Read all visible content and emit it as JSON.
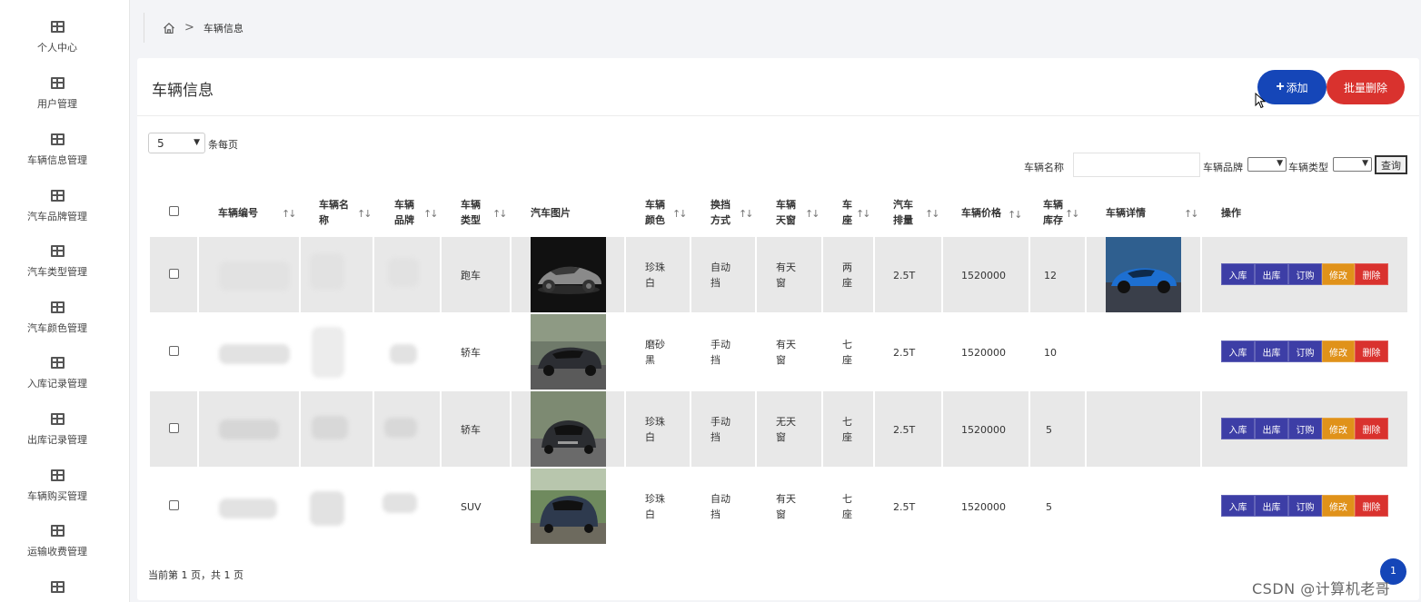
{
  "sidebar": {
    "items": [
      {
        "label": "个人中心"
      },
      {
        "label": "用户管理"
      },
      {
        "label": "车辆信息管理"
      },
      {
        "label": "汽车品牌管理"
      },
      {
        "label": "汽车类型管理"
      },
      {
        "label": "汽车颜色管理"
      },
      {
        "label": "入库记录管理"
      },
      {
        "label": "出库记录管理"
      },
      {
        "label": "车辆购买管理"
      },
      {
        "label": "运输收费管理"
      },
      {
        "label": ""
      }
    ]
  },
  "breadcrumb": {
    "separator": ">",
    "current": "车辆信息"
  },
  "page": {
    "title": "车辆信息"
  },
  "actions": {
    "add_label": "添加",
    "add_icon": "+",
    "batch_delete_label": "批量删除"
  },
  "pagination": {
    "page_size": "5",
    "per_page_label": "条每页",
    "footer": "当前第 1 页，共 1 页",
    "current_page": "1"
  },
  "search": {
    "name_label": "车辆名称",
    "name_value": "",
    "brand_label": "车辆品牌",
    "type_label": "车辆类型",
    "query_label": "查询"
  },
  "table": {
    "headers": {
      "id": "车辆编号",
      "name": "车辆名称",
      "brand": "车辆品牌",
      "type": "车辆类型",
      "image": "汽车图片",
      "color": "车辆颜色",
      "gear": "换挡方式",
      "sunroof": "车辆天窗",
      "seats": "车座",
      "displacement": "汽车排量",
      "price": "车辆价格",
      "stock": "车辆库存",
      "details": "车辆详情",
      "ops": "操作"
    },
    "sort_icon": "↑↓",
    "rows": [
      {
        "type": "跑车",
        "color": "珍珠白",
        "gear": "自动挡",
        "sunroof": "有天窗",
        "seats": "两座",
        "displacement": "2.5T",
        "price": "1520000",
        "stock": "12",
        "has_detail_image": true
      },
      {
        "type": "轿车",
        "color": "磨砂黑",
        "gear": "手动挡",
        "sunroof": "有天窗",
        "seats": "七座",
        "displacement": "2.5T",
        "price": "1520000",
        "stock": "10",
        "has_detail_image": false
      },
      {
        "type": "轿车",
        "color": "珍珠白",
        "gear": "手动挡",
        "sunroof": "无天窗",
        "seats": "七座",
        "displacement": "2.5T",
        "price": "1520000",
        "stock": "5",
        "has_detail_image": false
      },
      {
        "type": "SUV",
        "color": "珍珠白",
        "gear": "自动挡",
        "sunroof": "有天窗",
        "seats": "七座",
        "displacement": "2.5T",
        "price": "1520000",
        "stock": "5",
        "has_detail_image": false
      }
    ],
    "row_actions": {
      "in": "入库",
      "out": "出库",
      "order": "订购",
      "edit": "修改",
      "delete": "删除"
    }
  },
  "colors": {
    "primary": "#1546b8",
    "danger": "#d9322e",
    "action": "#3d3ea6",
    "warning": "#e0921a"
  },
  "watermark": "CSDN @计算机老哥"
}
